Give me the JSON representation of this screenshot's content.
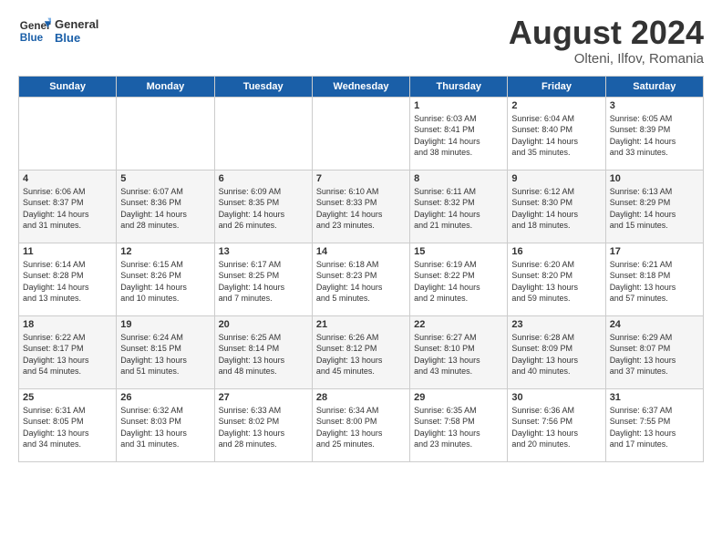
{
  "logo": {
    "line1": "General",
    "line2": "Blue"
  },
  "title": "August 2024",
  "location": "Olteni, Ilfov, Romania",
  "days_of_week": [
    "Sunday",
    "Monday",
    "Tuesday",
    "Wednesday",
    "Thursday",
    "Friday",
    "Saturday"
  ],
  "weeks": [
    [
      {
        "day": "",
        "info": ""
      },
      {
        "day": "",
        "info": ""
      },
      {
        "day": "",
        "info": ""
      },
      {
        "day": "",
        "info": ""
      },
      {
        "day": "1",
        "info": "Sunrise: 6:03 AM\nSunset: 8:41 PM\nDaylight: 14 hours\nand 38 minutes."
      },
      {
        "day": "2",
        "info": "Sunrise: 6:04 AM\nSunset: 8:40 PM\nDaylight: 14 hours\nand 35 minutes."
      },
      {
        "day": "3",
        "info": "Sunrise: 6:05 AM\nSunset: 8:39 PM\nDaylight: 14 hours\nand 33 minutes."
      }
    ],
    [
      {
        "day": "4",
        "info": "Sunrise: 6:06 AM\nSunset: 8:37 PM\nDaylight: 14 hours\nand 31 minutes."
      },
      {
        "day": "5",
        "info": "Sunrise: 6:07 AM\nSunset: 8:36 PM\nDaylight: 14 hours\nand 28 minutes."
      },
      {
        "day": "6",
        "info": "Sunrise: 6:09 AM\nSunset: 8:35 PM\nDaylight: 14 hours\nand 26 minutes."
      },
      {
        "day": "7",
        "info": "Sunrise: 6:10 AM\nSunset: 8:33 PM\nDaylight: 14 hours\nand 23 minutes."
      },
      {
        "day": "8",
        "info": "Sunrise: 6:11 AM\nSunset: 8:32 PM\nDaylight: 14 hours\nand 21 minutes."
      },
      {
        "day": "9",
        "info": "Sunrise: 6:12 AM\nSunset: 8:30 PM\nDaylight: 14 hours\nand 18 minutes."
      },
      {
        "day": "10",
        "info": "Sunrise: 6:13 AM\nSunset: 8:29 PM\nDaylight: 14 hours\nand 15 minutes."
      }
    ],
    [
      {
        "day": "11",
        "info": "Sunrise: 6:14 AM\nSunset: 8:28 PM\nDaylight: 14 hours\nand 13 minutes."
      },
      {
        "day": "12",
        "info": "Sunrise: 6:15 AM\nSunset: 8:26 PM\nDaylight: 14 hours\nand 10 minutes."
      },
      {
        "day": "13",
        "info": "Sunrise: 6:17 AM\nSunset: 8:25 PM\nDaylight: 14 hours\nand 7 minutes."
      },
      {
        "day": "14",
        "info": "Sunrise: 6:18 AM\nSunset: 8:23 PM\nDaylight: 14 hours\nand 5 minutes."
      },
      {
        "day": "15",
        "info": "Sunrise: 6:19 AM\nSunset: 8:22 PM\nDaylight: 14 hours\nand 2 minutes."
      },
      {
        "day": "16",
        "info": "Sunrise: 6:20 AM\nSunset: 8:20 PM\nDaylight: 13 hours\nand 59 minutes."
      },
      {
        "day": "17",
        "info": "Sunrise: 6:21 AM\nSunset: 8:18 PM\nDaylight: 13 hours\nand 57 minutes."
      }
    ],
    [
      {
        "day": "18",
        "info": "Sunrise: 6:22 AM\nSunset: 8:17 PM\nDaylight: 13 hours\nand 54 minutes."
      },
      {
        "day": "19",
        "info": "Sunrise: 6:24 AM\nSunset: 8:15 PM\nDaylight: 13 hours\nand 51 minutes."
      },
      {
        "day": "20",
        "info": "Sunrise: 6:25 AM\nSunset: 8:14 PM\nDaylight: 13 hours\nand 48 minutes."
      },
      {
        "day": "21",
        "info": "Sunrise: 6:26 AM\nSunset: 8:12 PM\nDaylight: 13 hours\nand 45 minutes."
      },
      {
        "day": "22",
        "info": "Sunrise: 6:27 AM\nSunset: 8:10 PM\nDaylight: 13 hours\nand 43 minutes."
      },
      {
        "day": "23",
        "info": "Sunrise: 6:28 AM\nSunset: 8:09 PM\nDaylight: 13 hours\nand 40 minutes."
      },
      {
        "day": "24",
        "info": "Sunrise: 6:29 AM\nSunset: 8:07 PM\nDaylight: 13 hours\nand 37 minutes."
      }
    ],
    [
      {
        "day": "25",
        "info": "Sunrise: 6:31 AM\nSunset: 8:05 PM\nDaylight: 13 hours\nand 34 minutes."
      },
      {
        "day": "26",
        "info": "Sunrise: 6:32 AM\nSunset: 8:03 PM\nDaylight: 13 hours\nand 31 minutes."
      },
      {
        "day": "27",
        "info": "Sunrise: 6:33 AM\nSunset: 8:02 PM\nDaylight: 13 hours\nand 28 minutes."
      },
      {
        "day": "28",
        "info": "Sunrise: 6:34 AM\nSunset: 8:00 PM\nDaylight: 13 hours\nand 25 minutes."
      },
      {
        "day": "29",
        "info": "Sunrise: 6:35 AM\nSunset: 7:58 PM\nDaylight: 13 hours\nand 23 minutes."
      },
      {
        "day": "30",
        "info": "Sunrise: 6:36 AM\nSunset: 7:56 PM\nDaylight: 13 hours\nand 20 minutes."
      },
      {
        "day": "31",
        "info": "Sunrise: 6:37 AM\nSunset: 7:55 PM\nDaylight: 13 hours\nand 17 minutes."
      }
    ]
  ]
}
